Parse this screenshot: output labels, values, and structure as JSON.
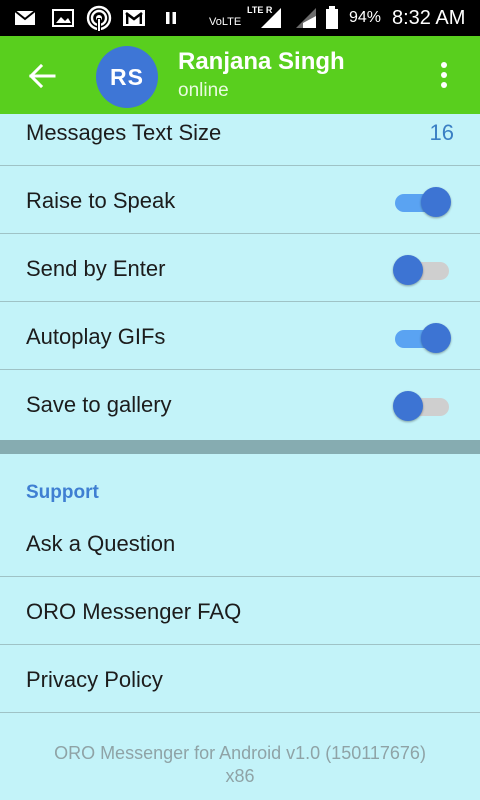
{
  "status_bar": {
    "network_label": "VoLTE",
    "lte_label": "LTE R",
    "battery": "94%",
    "time": "8:32 AM",
    "icons": [
      "mail-icon",
      "image-icon",
      "hotspot-icon",
      "gmail-icon",
      "pause-icon",
      "signal-icon",
      "battery-icon"
    ]
  },
  "header": {
    "avatar_initials": "RS",
    "avatar_color": "#3e76d6",
    "name": "Ranjana Singh",
    "status": "online",
    "bar_color": "#59cf1e"
  },
  "settings": {
    "text_size": {
      "label": "Messages Text Size",
      "value": "16"
    },
    "raise_to_speak": {
      "label": "Raise to Speak",
      "enabled": true
    },
    "send_by_enter": {
      "label": "Send by Enter",
      "enabled": false
    },
    "autoplay_gifs": {
      "label": "Autoplay GIFs",
      "enabled": true
    },
    "save_to_gallery": {
      "label": "Save to gallery",
      "enabled": false
    }
  },
  "support": {
    "header": "Support",
    "items": [
      "Ask a Question",
      "ORO Messenger FAQ",
      "Privacy Policy"
    ]
  },
  "footer": {
    "line1": "ORO Messenger for Android v1.0 (150117676)",
    "line2": "x86"
  }
}
